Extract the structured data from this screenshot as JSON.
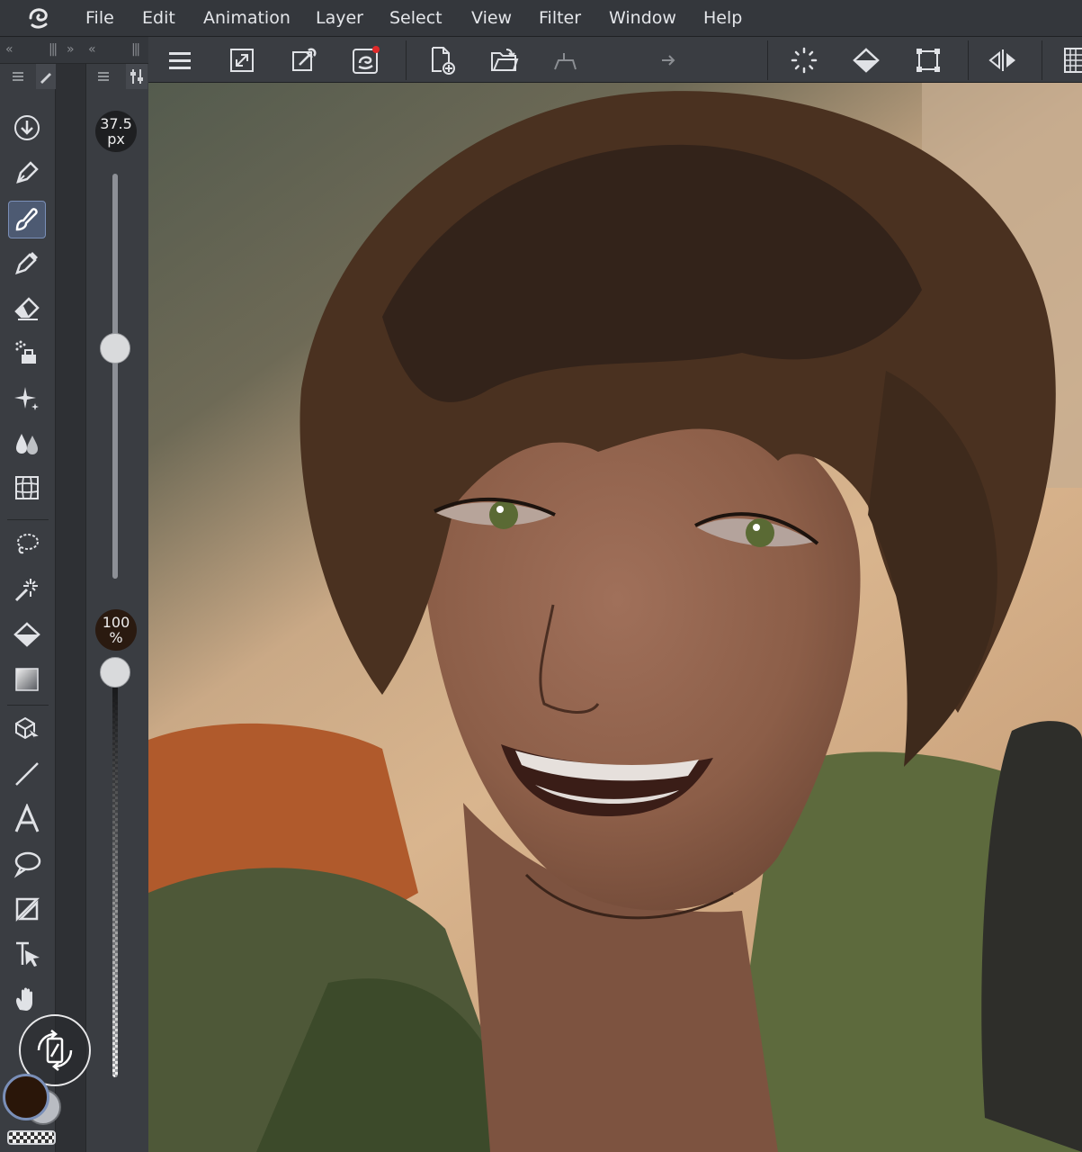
{
  "menubar": {
    "items": [
      {
        "label": "File"
      },
      {
        "label": "Edit"
      },
      {
        "label": "Animation"
      },
      {
        "label": "Layer"
      },
      {
        "label": "Select"
      },
      {
        "label": "View"
      },
      {
        "label": "Filter"
      },
      {
        "label": "Window"
      },
      {
        "label": "Help"
      }
    ]
  },
  "toolbar": {
    "icons": [
      "hamburger-menu-icon",
      "resize-canvas-icon",
      "eyedropper-icon",
      "clip-studio-icon",
      "new-file-icon",
      "open-folder-icon",
      "undo-icon",
      "redo-icon",
      "selection-launcher-icon",
      "fill-bucket-icon",
      "transform-icon",
      "flip-horizontal-icon",
      "grid-icon"
    ]
  },
  "tools": {
    "items": [
      "download-icon",
      "pen-icon",
      "brush-icon",
      "decoration-pen-icon",
      "eraser-icon",
      "airbrush-icon",
      "sparkle-icon",
      "blend-icon",
      "mesh-icon",
      "lasso-icon",
      "magic-wand-icon",
      "fill-icon",
      "gradient-icon",
      "object-select-icon",
      "line-icon",
      "text-icon",
      "balloon-icon",
      "frame-icon",
      "operation-icon",
      "hand-icon"
    ],
    "active": "brush-icon"
  },
  "brush_size": {
    "value": "37.5",
    "unit": "px",
    "level": 0.57
  },
  "opacity": {
    "value": "100",
    "unit": "%",
    "level": 1.0
  },
  "colors": {
    "main": "#2a1609",
    "sub": "#b9bcc2",
    "accent": "#7a8fb8",
    "record_dot": "#e02a2a"
  }
}
